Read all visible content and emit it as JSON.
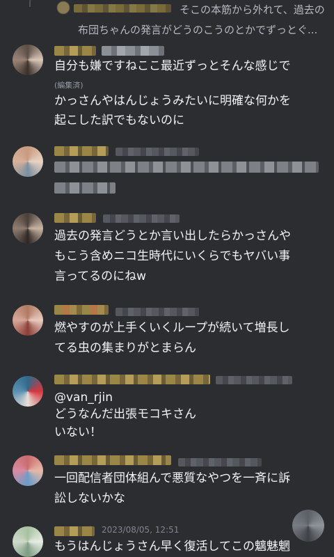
{
  "reply_preview": {
    "line1": "そこの本筋から外れて、過去の",
    "line2": "布団ちゃんの発言がどうのこうのとかでずっとぐ..."
  },
  "messages": [
    {
      "lines": [
        "自分も嫌ですねここ最近ずっとそんな感じで"
      ],
      "edited": "(編集済)",
      "lines2": [
        "かっさんやはんじょうみたいに明確な何かを",
        "起こした訳でもないのに"
      ]
    },
    {
      "lines": []
    },
    {
      "lines": [
        "過去の発言どうとか言い出したらかっさんや",
        "もこう含めニコ生時代にいくらでもヤバい事",
        "言ってるのにねw"
      ]
    },
    {
      "lines": [
        "燃やすのが上手くいくループが続いて増長し",
        "てる虫の集まりがとまらん"
      ]
    },
    {
      "mention": "@van_rjin",
      "lines": [
        "どうなんだ出張モコキさん",
        "いない！"
      ]
    },
    {
      "lines": [
        "一回配信者団体組んで悪質なやつを一斉に訴",
        "訟しないかな"
      ]
    },
    {
      "timestamp": "2023/08/05, 12:51",
      "lines": [
        "もうはんじょうさん早く復活してこの魑魅魍"
      ]
    }
  ],
  "icons": {
    "scroll_button": "scroll-to-bottom-icon"
  }
}
